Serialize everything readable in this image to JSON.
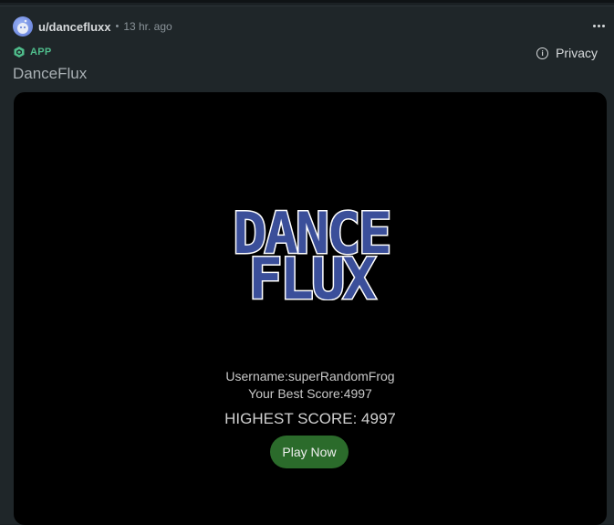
{
  "post": {
    "username": "u/dancefluxx",
    "separator": "•",
    "time": "13 hr. ago"
  },
  "app_tag": {
    "label": "APP",
    "icon": "hexagon-app-icon",
    "color": "#4fbc8b"
  },
  "privacy": {
    "icon_glyph": "i",
    "label": "Privacy"
  },
  "title": "DanceFlux",
  "game": {
    "logo_line1": "DANCE",
    "logo_line2": "FLUX",
    "username_label": "Username:",
    "username_value": "superRandomFrog",
    "best_score_label": "Your Best Score:",
    "best_score_value": "4997",
    "highest_score_label": "HIGHEST SCORE:",
    "highest_score_value": "4997",
    "play_button": "Play Now",
    "play_button_color": "#2b6b2b",
    "logo_color": "#3b4f9a"
  }
}
